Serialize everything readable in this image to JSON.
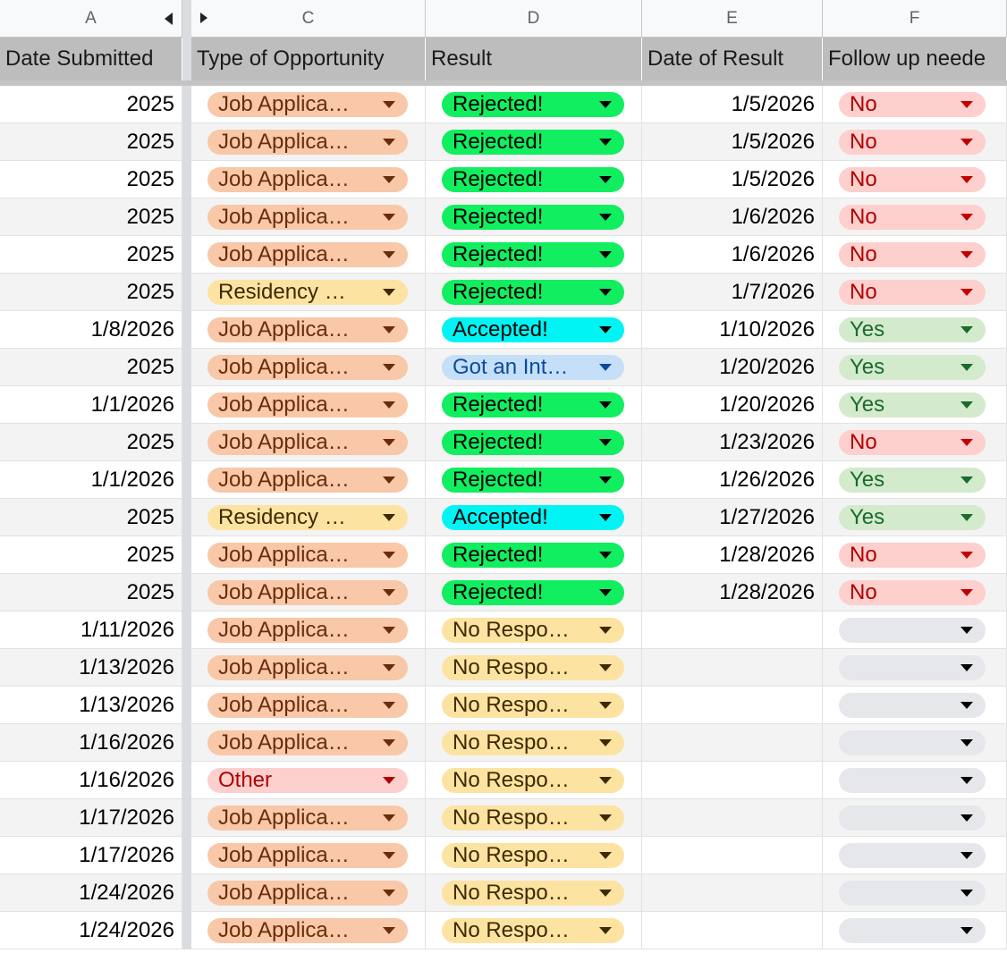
{
  "columns": {
    "a": "A",
    "c": "C",
    "d": "D",
    "e": "E",
    "f": "F"
  },
  "headers": {
    "date_submitted": "Date Submitted",
    "type": "Type of Opportunity",
    "result": "Result",
    "date_result": "Date of Result",
    "follow_up": "Follow up neede"
  },
  "colors": {
    "job_application": "#f8c8a8",
    "residency": "#fde3a2",
    "other": "#fdcfcd",
    "rejected": "#11ee5f",
    "accepted": "#00f4f4",
    "interview": "#c5dff8",
    "no_response": "#fde3a2",
    "no": "#fdcfcd",
    "yes": "#d3eacd",
    "empty": "#e6e7ea"
  },
  "rows": [
    {
      "date_submitted": "2025",
      "type": "Job Applica…",
      "type_kind": "job",
      "result": "Rejected!",
      "result_kind": "rej",
      "date_result": "1/5/2026",
      "follow": "No",
      "follow_kind": "no"
    },
    {
      "date_submitted": "2025",
      "type": "Job Applica…",
      "type_kind": "job",
      "result": "Rejected!",
      "result_kind": "rej",
      "date_result": "1/5/2026",
      "follow": "No",
      "follow_kind": "no"
    },
    {
      "date_submitted": "2025",
      "type": "Job Applica…",
      "type_kind": "job",
      "result": "Rejected!",
      "result_kind": "rej",
      "date_result": "1/5/2026",
      "follow": "No",
      "follow_kind": "no"
    },
    {
      "date_submitted": "2025",
      "type": "Job Applica…",
      "type_kind": "job",
      "result": "Rejected!",
      "result_kind": "rej",
      "date_result": "1/6/2026",
      "follow": "No",
      "follow_kind": "no"
    },
    {
      "date_submitted": "2025",
      "type": "Job Applica…",
      "type_kind": "job",
      "result": "Rejected!",
      "result_kind": "rej",
      "date_result": "1/6/2026",
      "follow": "No",
      "follow_kind": "no"
    },
    {
      "date_submitted": "2025",
      "type": "Residency …",
      "type_kind": "res",
      "result": "Rejected!",
      "result_kind": "rej",
      "date_result": "1/7/2026",
      "follow": "No",
      "follow_kind": "no"
    },
    {
      "date_submitted": "1/8/2026",
      "type": "Job Applica…",
      "type_kind": "job",
      "result": "Accepted!",
      "result_kind": "acc",
      "date_result": "1/10/2026",
      "follow": "Yes",
      "follow_kind": "yes"
    },
    {
      "date_submitted": "2025",
      "type": "Job Applica…",
      "type_kind": "job",
      "result": "Got an Int…",
      "result_kind": "int",
      "date_result": "1/20/2026",
      "follow": "Yes",
      "follow_kind": "yes"
    },
    {
      "date_submitted": "1/1/2026",
      "type": "Job Applica…",
      "type_kind": "job",
      "result": "Rejected!",
      "result_kind": "rej",
      "date_result": "1/20/2026",
      "follow": "Yes",
      "follow_kind": "yes"
    },
    {
      "date_submitted": "2025",
      "type": "Job Applica…",
      "type_kind": "job",
      "result": "Rejected!",
      "result_kind": "rej",
      "date_result": "1/23/2026",
      "follow": "No",
      "follow_kind": "no"
    },
    {
      "date_submitted": "1/1/2026",
      "type": "Job Applica…",
      "type_kind": "job",
      "result": "Rejected!",
      "result_kind": "rej",
      "date_result": "1/26/2026",
      "follow": "Yes",
      "follow_kind": "yes"
    },
    {
      "date_submitted": "2025",
      "type": "Residency …",
      "type_kind": "res",
      "result": "Accepted!",
      "result_kind": "acc",
      "date_result": "1/27/2026",
      "follow": "Yes",
      "follow_kind": "yes"
    },
    {
      "date_submitted": "2025",
      "type": "Job Applica…",
      "type_kind": "job",
      "result": "Rejected!",
      "result_kind": "rej",
      "date_result": "1/28/2026",
      "follow": "No",
      "follow_kind": "no"
    },
    {
      "date_submitted": "2025",
      "type": "Job Applica…",
      "type_kind": "job",
      "result": "Rejected!",
      "result_kind": "rej",
      "date_result": "1/28/2026",
      "follow": "No",
      "follow_kind": "no"
    },
    {
      "date_submitted": "1/11/2026",
      "type": "Job Applica…",
      "type_kind": "job",
      "result": "No Respo…",
      "result_kind": "nor",
      "date_result": "",
      "follow": "",
      "follow_kind": "empty"
    },
    {
      "date_submitted": "1/13/2026",
      "type": "Job Applica…",
      "type_kind": "job",
      "result": "No Respo…",
      "result_kind": "nor",
      "date_result": "",
      "follow": "",
      "follow_kind": "empty"
    },
    {
      "date_submitted": "1/13/2026",
      "type": "Job Applica…",
      "type_kind": "job",
      "result": "No Respo…",
      "result_kind": "nor",
      "date_result": "",
      "follow": "",
      "follow_kind": "empty"
    },
    {
      "date_submitted": "1/16/2026",
      "type": "Job Applica…",
      "type_kind": "job",
      "result": "No Respo…",
      "result_kind": "nor",
      "date_result": "",
      "follow": "",
      "follow_kind": "empty"
    },
    {
      "date_submitted": "1/16/2026",
      "type": "Other",
      "type_kind": "oth",
      "result": "No Respo…",
      "result_kind": "nor",
      "date_result": "",
      "follow": "",
      "follow_kind": "empty"
    },
    {
      "date_submitted": "1/17/2026",
      "type": "Job Applica…",
      "type_kind": "job",
      "result": "No Respo…",
      "result_kind": "nor",
      "date_result": "",
      "follow": "",
      "follow_kind": "empty"
    },
    {
      "date_submitted": "1/17/2026",
      "type": "Job Applica…",
      "type_kind": "job",
      "result": "No Respo…",
      "result_kind": "nor",
      "date_result": "",
      "follow": "",
      "follow_kind": "empty"
    },
    {
      "date_submitted": "1/24/2026",
      "type": "Job Applica…",
      "type_kind": "job",
      "result": "No Respo…",
      "result_kind": "nor",
      "date_result": "",
      "follow": "",
      "follow_kind": "empty"
    },
    {
      "date_submitted": "1/24/2026",
      "type": "Job Applica…",
      "type_kind": "job",
      "result": "No Respo…",
      "result_kind": "nor",
      "date_result": "",
      "follow": "",
      "follow_kind": "empty"
    }
  ]
}
